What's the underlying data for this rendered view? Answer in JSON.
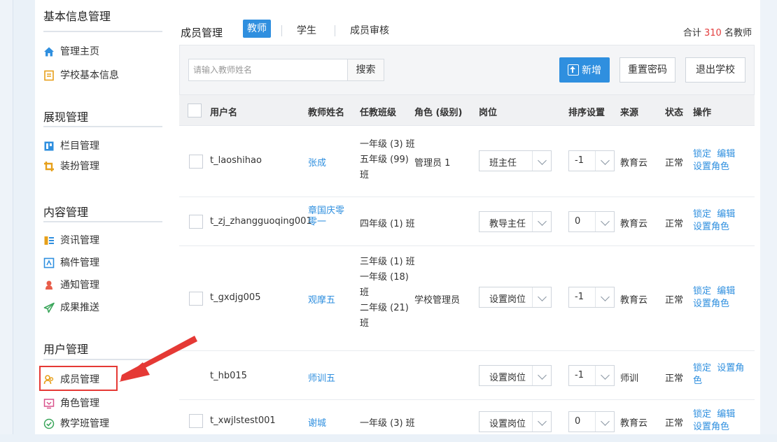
{
  "sidebar": {
    "sections": [
      {
        "title": "基本信息管理",
        "items": [
          {
            "label": "管理主页",
            "icon": "home-icon"
          },
          {
            "label": "学校基本信息",
            "icon": "document-icon"
          }
        ]
      },
      {
        "title": "展现管理",
        "items": [
          {
            "label": "栏目管理",
            "icon": "column-icon"
          },
          {
            "label": "装扮管理",
            "icon": "crop-icon"
          }
        ]
      },
      {
        "title": "内容管理",
        "items": [
          {
            "label": "资讯管理",
            "icon": "news-icon"
          },
          {
            "label": "稿件管理",
            "icon": "manuscript-icon"
          },
          {
            "label": "通知管理",
            "icon": "bell-icon"
          },
          {
            "label": "成果推送",
            "icon": "send-icon"
          }
        ]
      },
      {
        "title": "用户管理",
        "items": [
          {
            "label": "成员管理",
            "icon": "members-icon"
          },
          {
            "label": "角色管理",
            "icon": "role-icon"
          },
          {
            "label": "教学班管理",
            "icon": "check-circle-icon"
          }
        ]
      }
    ]
  },
  "header": {
    "title": "成员管理",
    "tabs": [
      "教师",
      "学生",
      "成员审核"
    ],
    "total_prefix": "合计",
    "total_count": "310",
    "total_suffix": "名教师"
  },
  "toolbar": {
    "search_placeholder": "请输入教师姓名",
    "search_label": "搜索",
    "new_label": "新增",
    "reset_label": "重置密码",
    "exit_label": "退出学校"
  },
  "table": {
    "columns": [
      "用户名",
      "教师姓名",
      "任教班级",
      "角色 (级别)",
      "岗位",
      "排序设置",
      "来源",
      "状态",
      "操作"
    ],
    "rows": [
      {
        "username": "t_laoshihao",
        "name": "张成",
        "classes": [
          "一年级 (3) 班",
          "五年级 (99)",
          "班"
        ],
        "role": "管理员 1",
        "post": "班主任",
        "order": "-1",
        "source": "教育云",
        "status": "正常",
        "ops": [
          "锁定",
          "编辑",
          "设置角色"
        ]
      },
      {
        "username": "t_zj_zhangguoqing001",
        "name": "章国庆零零一",
        "classes": [
          "四年级 (1) 班"
        ],
        "role": "",
        "post": "教导主任",
        "order": "0",
        "source": "教育云",
        "status": "正常",
        "ops": [
          "锁定",
          "编辑",
          "设置角色"
        ]
      },
      {
        "username": "t_gxdjg005",
        "name": "观摩五",
        "classes": [
          "三年级 (1) 班",
          "一年级 (18)",
          "班",
          "二年级 (21)",
          "班"
        ],
        "role": "学校管理员",
        "post": "设置岗位",
        "order": "-1",
        "source": "教育云",
        "status": "正常",
        "ops": [
          "锁定",
          "编辑",
          "设置角色"
        ]
      },
      {
        "username": "t_hb015",
        "name": "师训五",
        "classes": [],
        "role": "",
        "post": "设置岗位",
        "order": "-1",
        "source": "师训",
        "status": "正常",
        "ops": [
          "锁定",
          "设置角",
          "色"
        ]
      },
      {
        "username": "t_xwjlstest001",
        "name": "谢城",
        "classes": [
          "一年级 (3) 班"
        ],
        "role": "",
        "post": "设置岗位",
        "order": "0",
        "source": "教育云",
        "status": "正常",
        "ops": [
          "锁定",
          "编辑",
          "设置角色"
        ]
      }
    ]
  },
  "colors": {
    "accent": "#2f8fdf",
    "highlight": "#e53935",
    "count": "#e23c3c"
  }
}
